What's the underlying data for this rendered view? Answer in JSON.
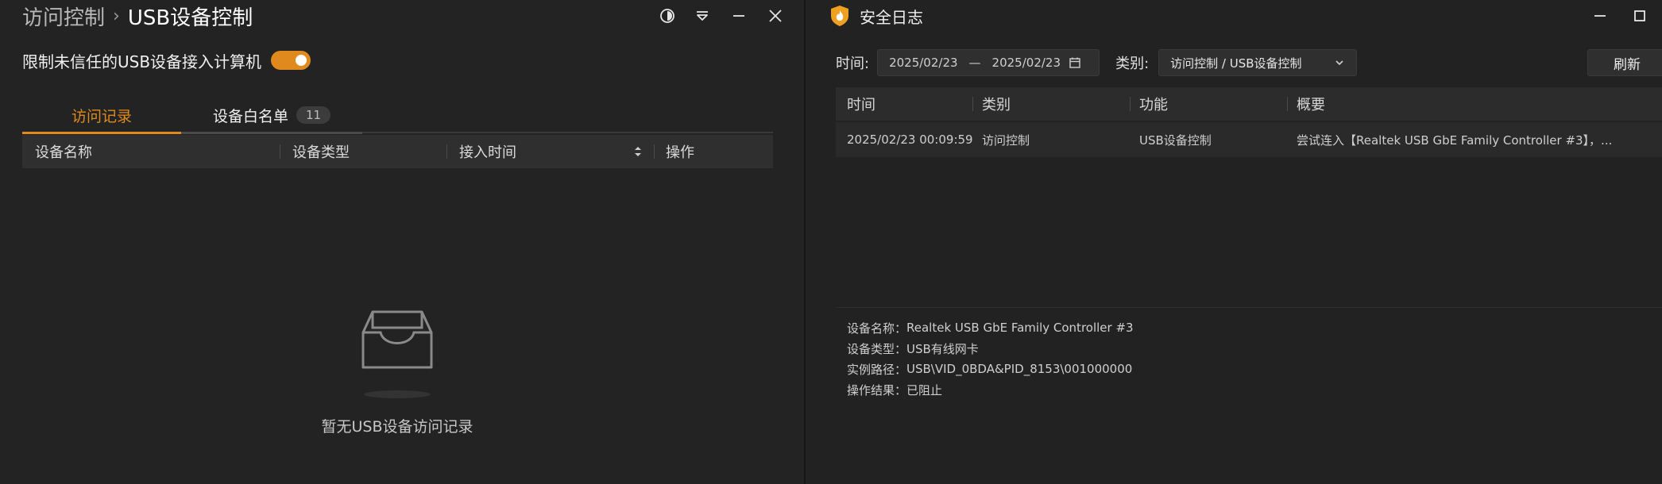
{
  "left_window": {
    "breadcrumb": {
      "parent": "访问控制",
      "separator": "›",
      "current": "USB设备控制"
    },
    "window_controls": [
      "theme-icon",
      "dropdown-icon",
      "minimize-icon",
      "close-icon"
    ],
    "toggle": {
      "label": "限制未信任的USB设备接入计算机",
      "on": true,
      "color": "#e08a1e"
    },
    "tabs": [
      {
        "label": "访问记录",
        "active": true
      },
      {
        "label": "设备白名单",
        "badge": "11",
        "active": false
      }
    ],
    "table": {
      "columns": [
        "设备名称",
        "设备类型",
        "接入时间",
        "操作"
      ]
    },
    "empty_state": {
      "icon": "empty-inbox-icon",
      "text": "暂无USB设备访问记录"
    }
  },
  "right_window": {
    "title": "安全日志",
    "app_icon": "shield-flame-icon",
    "window_controls": [
      "minimize-icon",
      "maximize-icon"
    ],
    "filter": {
      "time_label": "时间:",
      "date_start": "2025/02/23",
      "date_sep": "—",
      "date_end": "2025/02/23",
      "category_label": "类别:",
      "category_value": "访问控制 / USB设备控制",
      "refresh_label": "刷新"
    },
    "table": {
      "columns": [
        "时间",
        "类别",
        "功能",
        "概要"
      ],
      "rows": [
        {
          "time": "2025/02/23 00:09:59",
          "category": "访问控制",
          "function": "USB设备控制",
          "summary": "尝试连入【Realtek USB GbE Family Controller #3】，..."
        }
      ]
    },
    "details": [
      {
        "label": "设备名称：",
        "value": "Realtek USB GbE Family Controller #3"
      },
      {
        "label": "设备类型：",
        "value": "USB有线网卡"
      },
      {
        "label": "实例路径：",
        "value": "USB\\VID_0BDA&PID_8153\\001000000"
      },
      {
        "label": "操作结果：",
        "value": "已阻止"
      }
    ]
  }
}
